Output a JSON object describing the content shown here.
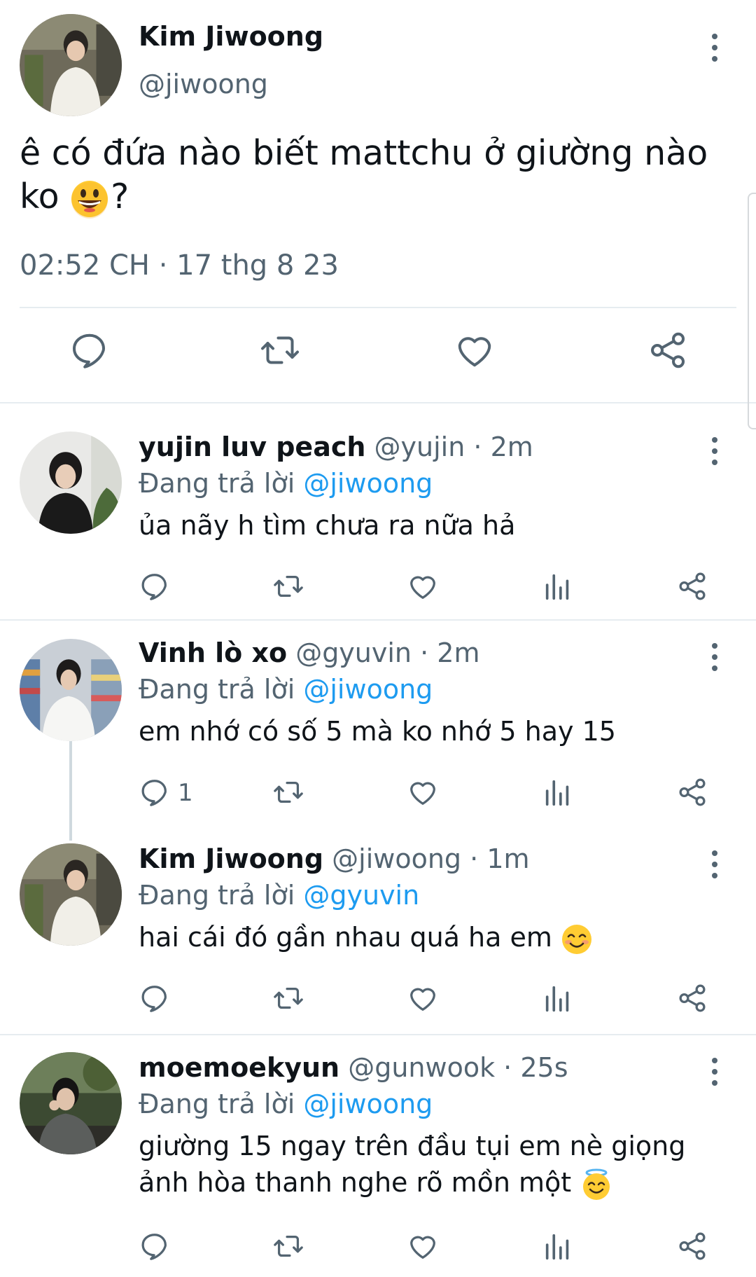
{
  "main_tweet": {
    "name": "Kim Jiwoong",
    "handle": "@jiwoong",
    "text_before_emoji": "ê có đứa nào biết mattchu ở giường nào ko",
    "text_after_emoji": "?",
    "emoji_icon": "grinning-face-emoji",
    "timestamp": "02:52 CH · 17 thg 8 23"
  },
  "replies": [
    {
      "name": "yujin luv peach",
      "handle": "@yujin",
      "separator": "·",
      "time": "2m",
      "replying_prefix": "Đang trả lời",
      "replying_to": "@jiwoong",
      "text": "ủa nãy h tìm chưa ra nữa hả",
      "reply_count": ""
    },
    {
      "name": "Vinh lò xo",
      "handle": "@gyuvin",
      "separator": "·",
      "time": "2m",
      "replying_prefix": "Đang trả lời",
      "replying_to": "@jiwoong",
      "text": "em nhớ có số 5 mà ko nhớ 5 hay 15",
      "reply_count": "1"
    },
    {
      "name": "Kim Jiwoong",
      "handle": "@jiwoong",
      "separator": "·",
      "time": "1m",
      "replying_prefix": "Đang trả lời",
      "replying_to": "@gyuvin",
      "text": "hai cái đó gần nhau quá ha em",
      "emoji_icon": "smiling-face-emoji",
      "reply_count": ""
    },
    {
      "name": "moemoekyun",
      "handle": "@gunwook",
      "separator": "·",
      "time": "25s",
      "replying_prefix": "Đang trả lời",
      "replying_to": "@jiwoong",
      "text_line1": "giường 15 ngay trên đầu tụi em nè giọng",
      "text_line2": "ảnh hòa thanh nghe rõ mồn một",
      "emoji_icon": "halo-face-emoji",
      "reply_count": ""
    }
  ],
  "icons": {
    "reply": "reply-bubble-icon",
    "retweet": "retweet-icon",
    "like": "heart-icon",
    "views": "analytics-icon",
    "share": "share-icon",
    "more": "more-vertical-icon"
  },
  "colors": {
    "text": "#0f1419",
    "secondary": "#536471",
    "link": "#1d9bf0",
    "divider": "#e6ecf0"
  }
}
